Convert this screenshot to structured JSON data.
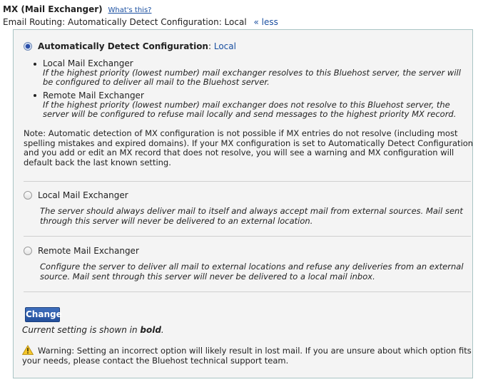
{
  "header": {
    "title": "MX (Mail Exchanger)",
    "help_link": "What's this?"
  },
  "routing": {
    "label": "Email Routing:",
    "value": "Automatically Detect Configuration: Local",
    "toggle": "« less"
  },
  "options": {
    "auto": {
      "label": "Automatically Detect Configuration",
      "separator": ": ",
      "value": "Local",
      "selected": true,
      "sub_local_title": "Local Mail Exchanger",
      "sub_local_desc": "If the highest priority (lowest number) mail exchanger resolves to this Bluehost server, the server will be configured to deliver all mail to the Bluehost server.",
      "sub_remote_title": "Remote Mail Exchanger",
      "sub_remote_desc": "If the highest priority (lowest number) mail exchanger does not resolve to this Bluehost server, the server will be configured to refuse mail locally and send messages to the highest priority MX record.",
      "note": "Note: Automatic detection of MX configuration is not possible if MX entries do not resolve (including most spelling mistakes and expired domains). If your MX configuration is set to Automatically Detect Configuration and you add or edit an MX record that does not resolve, you will see a warning and MX configuration will default back the last known setting."
    },
    "local": {
      "label": "Local Mail Exchanger",
      "selected": false,
      "desc": "The server should always deliver mail to itself and always accept mail from external sources. Mail sent through this server will never be delivered to an external location."
    },
    "remote": {
      "label": "Remote Mail Exchanger",
      "selected": false,
      "desc": "Configure the server to deliver all mail to external locations and refuse any deliveries from an external source. Mail sent through this server will never be delivered to a local mail inbox."
    }
  },
  "actions": {
    "change_label": "Change",
    "current_prefix": "Current setting is shown in ",
    "current_bold": "bold",
    "current_suffix": "."
  },
  "warning": {
    "icon": "warning-icon",
    "text": "Warning: Setting an incorrect option will likely result in lost mail. If you are unsure about which option fits your needs, please contact the Bluehost technical support team."
  },
  "colors": {
    "link": "#1a4fa0",
    "panel_bg": "#f4f4f4",
    "panel_border": "#a9c4c4",
    "button": "#2b5aa8"
  }
}
